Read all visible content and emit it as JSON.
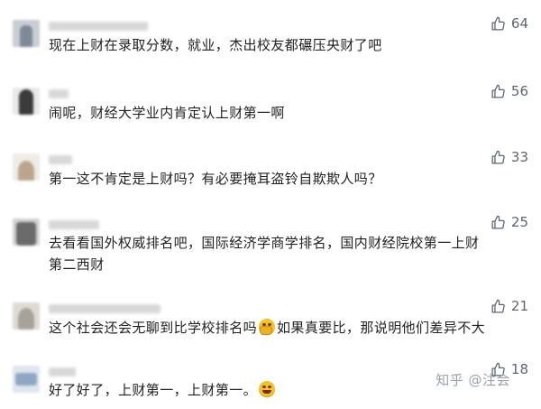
{
  "comments": [
    {
      "text": "现在上财在录取分数，就业，杰出校友都碾压央财了吧",
      "likes": "64",
      "avatar_colors": [
        "#7e8a96",
        "#c9ced3"
      ]
    },
    {
      "text": "闹呢，财经大学业内肯定认上财第一啊",
      "likes": "56",
      "avatar_colors": [
        "#3b3b3b",
        "#e9e9e9"
      ]
    },
    {
      "text": "第一这不肯定是上财吗？有必要掩耳盗铃自欺欺人吗？",
      "likes": "33",
      "avatar_colors": [
        "#b9a68d",
        "#efece7"
      ]
    },
    {
      "text": "去看看国外权威排名吧，国际经济学商学排名，国内财经院校第一上财\n第二西财",
      "likes": "25",
      "avatar_colors": [
        "#6b6b6b",
        "#d2d2d2"
      ]
    },
    {
      "text_before": "这个社会还会无聊到比学校排名吗",
      "text_after": "如果真要比，那说明他们差异不大",
      "likes": "21",
      "avatar_colors": [
        "#a7a39b",
        "#dedbd5"
      ]
    },
    {
      "text_before": "好了好了，上财第一，上财第一。",
      "text_after": "",
      "likes": "18",
      "avatar_colors": [
        "#8fa7c5",
        "#dfe6ef"
      ]
    }
  ],
  "icons": {
    "like": "thumbs-up-icon",
    "laugh_cry": "laughing-covering-face-emoji",
    "grin": "grinning-emoji"
  },
  "watermark": "知乎 @注会"
}
